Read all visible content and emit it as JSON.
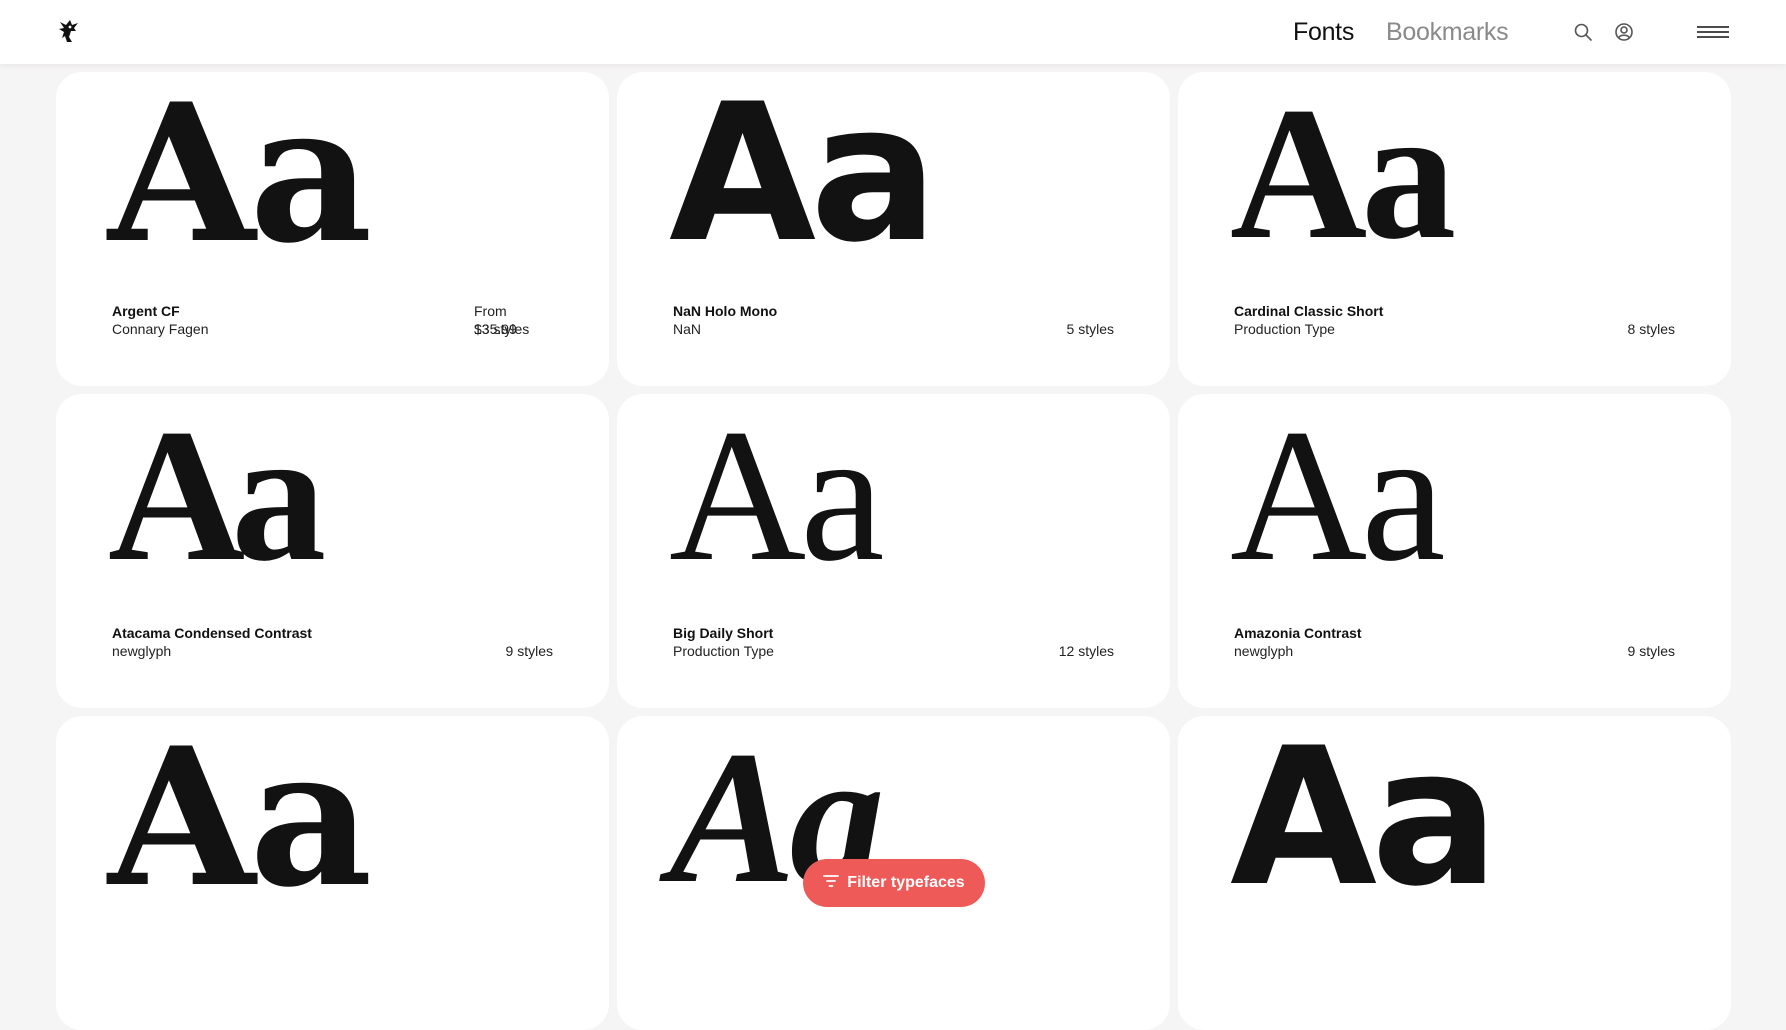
{
  "header": {
    "logo_icon": "ninja-logo-icon",
    "nav": {
      "fonts": "Fonts",
      "bookmarks": "Bookmarks"
    },
    "icons": {
      "search": "search-icon",
      "account": "account-icon",
      "menu": "hamburger-menu-icon"
    }
  },
  "specimen_text": "Aa",
  "cards": [
    {
      "name": "Argent CF",
      "foundry": "Connary Fagen",
      "price": "From $35.99",
      "styles": "13 styles"
    },
    {
      "name": "NaN Holo Mono",
      "foundry": "NaN",
      "price": "",
      "styles": "5 styles"
    },
    {
      "name": "Cardinal Classic Short",
      "foundry": "Production Type",
      "price": "",
      "styles": "8 styles"
    },
    {
      "name": "Atacama Condensed Contrast",
      "foundry": "newglyph",
      "price": "",
      "styles": "9 styles"
    },
    {
      "name": "Big Daily Short",
      "foundry": "Production Type",
      "price": "",
      "styles": "12 styles"
    },
    {
      "name": "Amazonia Contrast",
      "foundry": "newglyph",
      "price": "",
      "styles": "9 styles"
    },
    {
      "name": "",
      "foundry": "",
      "price": "",
      "styles": ""
    },
    {
      "name": "",
      "foundry": "",
      "price": "",
      "styles": ""
    },
    {
      "name": "",
      "foundry": "",
      "price": "",
      "styles": ""
    }
  ],
  "filter_button": {
    "label": "Filter typefaces",
    "icon": "filter-icon",
    "color": "#ee5a58"
  }
}
